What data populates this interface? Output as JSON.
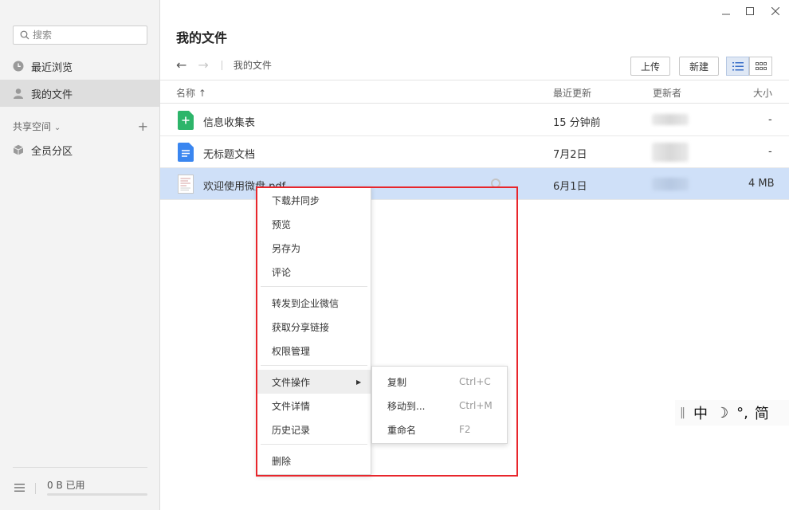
{
  "sidebar": {
    "search_placeholder": "搜索",
    "nav": [
      {
        "label": "最近浏览"
      },
      {
        "label": "我的文件"
      }
    ],
    "shared_space": "共享空间",
    "shared_items": [
      {
        "label": "全员分区"
      }
    ],
    "storage_used": "0 B 已用"
  },
  "header": {
    "title": "我的文件",
    "breadcrumb": "我的文件",
    "upload_label": "上传",
    "new_label": "新建"
  },
  "table": {
    "columns": {
      "name": "名称 ↑",
      "updated": "最近更新",
      "updater": "更新者",
      "size": "大小"
    },
    "rows": [
      {
        "name": "信息收集表",
        "updated": "15 分钟前",
        "size": "-"
      },
      {
        "name": "无标题文档",
        "updated": "7月2日",
        "size": "-"
      },
      {
        "name": "欢迎使用微盘.pdf",
        "updated": "6月1日",
        "size": "4 MB"
      }
    ]
  },
  "context_menu": {
    "items": [
      "下载并同步",
      "预览",
      "另存为",
      "评论",
      "转发到企业微信",
      "获取分享链接",
      "权限管理",
      "文件操作",
      "文件详情",
      "历史记录",
      "删除"
    ]
  },
  "submenu": {
    "items": [
      {
        "label": "复制",
        "shortcut": "Ctrl+C"
      },
      {
        "label": "移动到...",
        "shortcut": "Ctrl+M"
      },
      {
        "label": "重命名",
        "shortcut": "F2"
      }
    ]
  },
  "ime": {
    "mode": "中",
    "punct": "°,",
    "variant": "简"
  },
  "colors": {
    "highlight_box": "#e8262c",
    "selected_row": "#cfe0f8",
    "sheet_icon": "#2db56a",
    "doc_icon": "#3a86f0"
  }
}
